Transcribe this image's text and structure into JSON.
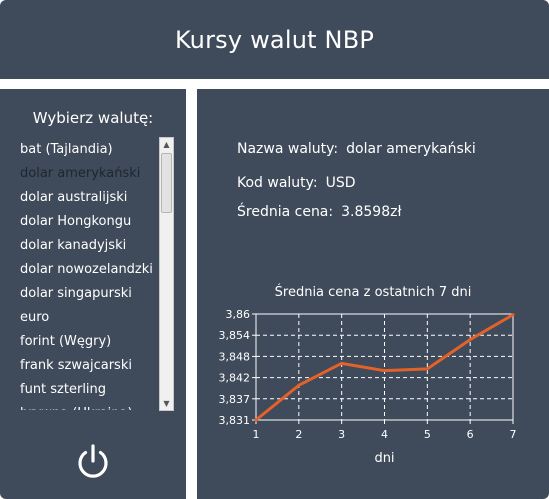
{
  "header": {
    "title": "Kursy walut NBP"
  },
  "sidebar": {
    "label": "Wybierz walutę:",
    "items": [
      "bat (Tajlandia)",
      "dolar amerykański",
      "dolar australijski",
      "dolar Hongkongu",
      "dolar kanadyjski",
      "dolar nowozelandzki",
      "dolar singapurski",
      "euro",
      "forint (Węgry)",
      "frank szwajcarski",
      "funt szterling",
      "hrywna (Ukraina)"
    ],
    "selected_index": 1,
    "power_icon": "power-icon"
  },
  "details": {
    "name_label": "Nazwa waluty:",
    "name_value": "dolar amerykański",
    "code_label": "Kod waluty:",
    "code_value": "USD",
    "price_label": "Średnia cena:",
    "price_value": "3.8598zł"
  },
  "chart_data": {
    "type": "line",
    "title": "Średnia cena z ostatnich 7 dni",
    "xlabel": "dni",
    "ylabel": "",
    "x": [
      1,
      2,
      3,
      4,
      5,
      6,
      7
    ],
    "values": [
      3.831,
      3.8405,
      3.8465,
      3.8445,
      3.845,
      3.853,
      3.8598
    ],
    "ylim": [
      3.831,
      3.86
    ],
    "y_ticks": [
      "3,86",
      "3,854",
      "3,848",
      "3,842",
      "3,837",
      "3,831"
    ],
    "x_ticks": [
      "1",
      "2",
      "3",
      "4",
      "5",
      "6",
      "7"
    ],
    "line_color": "#e2622a",
    "grid": true
  }
}
